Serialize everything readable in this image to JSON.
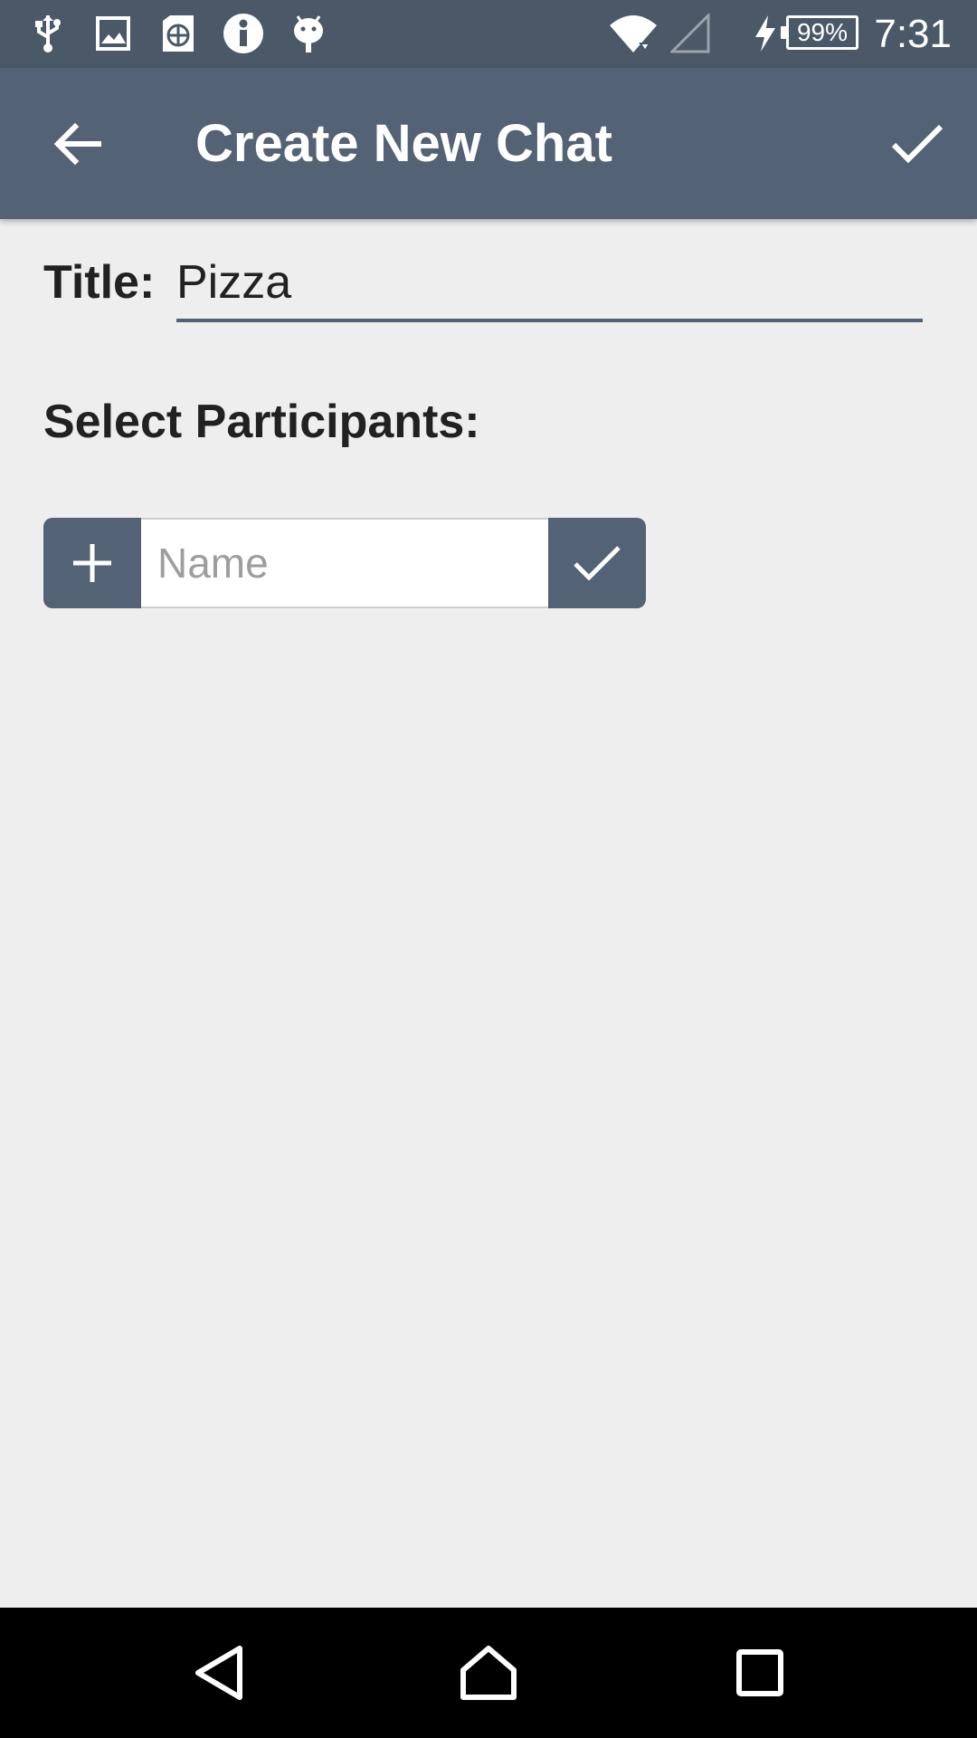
{
  "status_bar": {
    "time": "7:31",
    "battery": "99%",
    "icons": [
      "usb-icon",
      "image-icon",
      "globe-sim-icon",
      "info-icon",
      "android-icon",
      "wifi-icon",
      "signal-icon",
      "charging-icon",
      "battery-icon"
    ]
  },
  "app_bar": {
    "title": "Create New Chat",
    "back_icon": "arrow-back-icon",
    "confirm_icon": "check-icon"
  },
  "form": {
    "title_label": "Title:",
    "title_value": "Pizza",
    "participants_label": "Select Participants:",
    "name_placeholder": "Name",
    "add_icon": "plus-icon",
    "confirm_icon": "check-icon"
  },
  "nav_bar": {
    "icons": [
      "back-triangle-icon",
      "home-icon",
      "recents-icon"
    ]
  },
  "colors": {
    "status_bar": "#4a5868",
    "app_bar": "#536274",
    "background": "#eeeeee",
    "accent": "#536274"
  }
}
